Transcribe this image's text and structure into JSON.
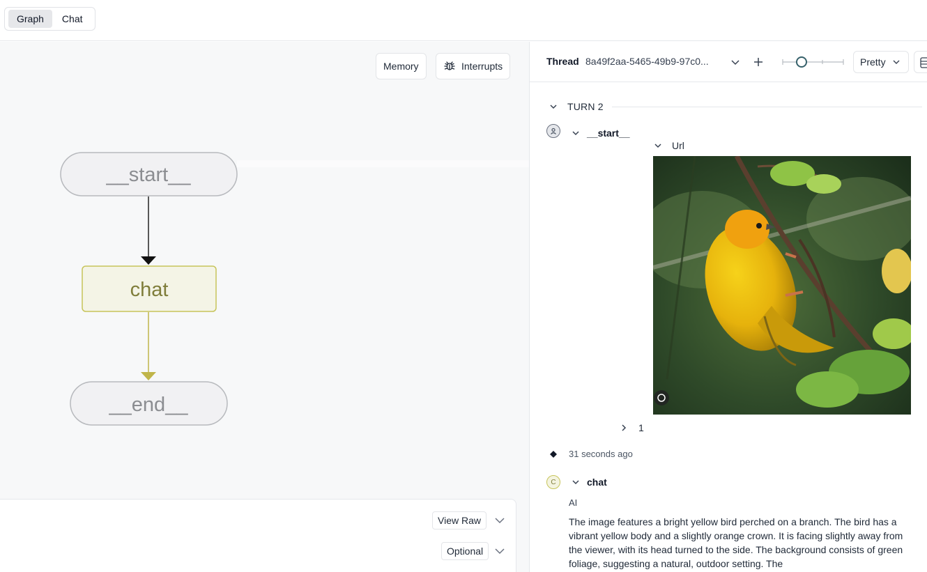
{
  "tabs": [
    {
      "label": "Graph",
      "active": true
    },
    {
      "label": "Chat",
      "active": false
    }
  ],
  "graph": {
    "memory_label": "Memory",
    "interrupts_label": "Interrupts",
    "nodes": {
      "start": "__start__",
      "chat": "chat",
      "end": "__end__"
    },
    "view_raw_label": "View Raw",
    "optional_label": "Optional"
  },
  "thread": {
    "label": "Thread",
    "id": "8a49f2aa-5465-49b9-97c0...",
    "view_mode": "Pretty",
    "turn_label": "TURN 2",
    "start_node": {
      "name": "__start__",
      "field_label": "Url",
      "collapsed_count": "1"
    },
    "timestamp": "31 seconds ago",
    "chat_node": {
      "avatar_letter": "C",
      "name": "chat",
      "role": "AI",
      "message": "The image features a bright yellow bird perched on a branch. The bird has a vibrant yellow body and a slightly orange crown. It is facing slightly away from the viewer, with its head turned to the side. The background consists of green foliage, suggesting a natural, outdoor setting. The"
    }
  },
  "colors": {
    "chat_node_fill": "#f4f4e6",
    "chat_node_border": "#c7c45a",
    "chat_edge": "#c0b54a",
    "panel_bg": "#f7f8f9"
  }
}
